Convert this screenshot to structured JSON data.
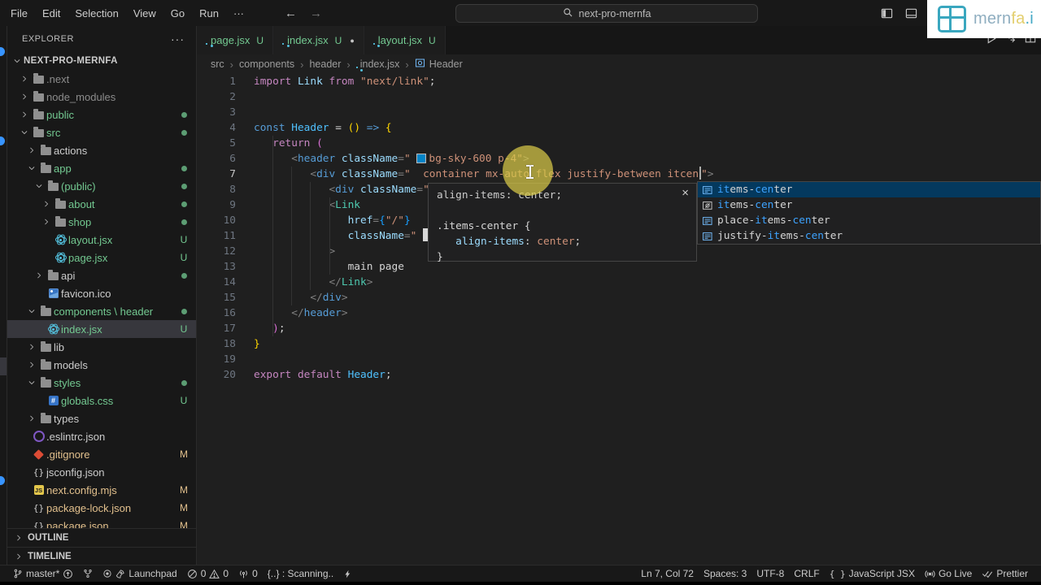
{
  "colors": {
    "untracked_green": "#73c991",
    "modified_orange": "#e2c08d",
    "suggest_selected_bg": "#04395e",
    "tailwind_chip": "#0284c7",
    "click_highlight": "#d8c948",
    "logo_teal": "#3aa7bf"
  },
  "title_bar": {
    "menus": [
      "File",
      "Edit",
      "Selection",
      "View",
      "Go",
      "Run",
      "···"
    ],
    "back_arrow": "←",
    "forward_arrow": "→",
    "search_value": "next-pro-mernfa"
  },
  "logo": {
    "parts": [
      {
        "text": "mern",
        "color": "#8fAEC0"
      },
      {
        "text": "fa",
        "color": "#e3cf6e"
      },
      {
        "text": ".i",
        "color": "#45a9c6"
      }
    ]
  },
  "explorer": {
    "header": "EXPLORER",
    "header_menu": "···",
    "sections": [
      {
        "label": "OUTLINE"
      },
      {
        "label": "TIMELINE"
      }
    ],
    "tree": [
      {
        "label": "NEXT-PRO-MERNFA",
        "depth": 0,
        "kind": "root",
        "state": "open",
        "color": "white"
      },
      {
        "label": ".next",
        "depth": 1,
        "kind": "folder",
        "state": "closed",
        "color": "gray"
      },
      {
        "label": "node_modules",
        "depth": 1,
        "kind": "folder",
        "state": "closed",
        "color": "gray"
      },
      {
        "label": "public",
        "depth": 1,
        "kind": "folder",
        "state": "closed",
        "color": "green",
        "badge": "dot"
      },
      {
        "label": "src",
        "depth": 1,
        "kind": "folder",
        "state": "open",
        "color": "green",
        "badge": "dot"
      },
      {
        "label": "actions",
        "depth": 2,
        "kind": "folder",
        "state": "closed",
        "color": "white"
      },
      {
        "label": "app",
        "depth": 2,
        "kind": "folder",
        "state": "open",
        "color": "green",
        "badge": "dot"
      },
      {
        "label": "(public)",
        "depth": 3,
        "kind": "folder",
        "state": "open",
        "color": "green",
        "badge": "dot"
      },
      {
        "label": "about",
        "depth": 4,
        "kind": "folder",
        "state": "closed",
        "color": "green",
        "badge": "dot"
      },
      {
        "label": "shop",
        "depth": 4,
        "kind": "folder",
        "state": "closed",
        "color": "green",
        "badge": "dot"
      },
      {
        "label": "layout.jsx",
        "depth": 4,
        "kind": "file",
        "icon": "react",
        "color": "green",
        "badge": "U"
      },
      {
        "label": "page.jsx",
        "depth": 4,
        "kind": "file",
        "icon": "react",
        "color": "green",
        "badge": "U"
      },
      {
        "label": "api",
        "depth": 3,
        "kind": "folder",
        "state": "closed",
        "color": "white",
        "badge": "dot"
      },
      {
        "label": "favicon.ico",
        "depth": 3,
        "kind": "file",
        "icon": "img",
        "color": "white"
      },
      {
        "label": "components \\ header",
        "depth": 2,
        "kind": "folder",
        "state": "open",
        "color": "green",
        "badge": "dot"
      },
      {
        "label": "index.jsx",
        "depth": 3,
        "kind": "file",
        "icon": "react",
        "color": "green",
        "badge": "U",
        "selected": true
      },
      {
        "label": "lib",
        "depth": 2,
        "kind": "folder",
        "state": "closed",
        "color": "white"
      },
      {
        "label": "models",
        "depth": 2,
        "kind": "folder",
        "state": "closed",
        "color": "white"
      },
      {
        "label": "styles",
        "depth": 2,
        "kind": "folder",
        "state": "open",
        "color": "green",
        "badge": "dot"
      },
      {
        "label": "globals.css",
        "depth": 3,
        "kind": "file",
        "icon": "css",
        "color": "green",
        "badge": "U"
      },
      {
        "label": "types",
        "depth": 2,
        "kind": "folder",
        "state": "closed",
        "color": "white"
      },
      {
        "label": ".eslintrc.json",
        "depth": 1,
        "kind": "file",
        "icon": "eslint",
        "color": "white"
      },
      {
        "label": ".gitignore",
        "depth": 1,
        "kind": "file",
        "icon": "git",
        "color": "orange",
        "badge": "M"
      },
      {
        "label": "jsconfig.json",
        "depth": 1,
        "kind": "file",
        "icon": "json",
        "color": "white"
      },
      {
        "label": "next.config.mjs",
        "depth": 1,
        "kind": "file",
        "icon": "js",
        "color": "orange",
        "badge": "M"
      },
      {
        "label": "package-lock.json",
        "depth": 1,
        "kind": "file",
        "icon": "json",
        "color": "orange",
        "badge": "M"
      },
      {
        "label": "package.json",
        "depth": 1,
        "kind": "file",
        "icon": "json",
        "color": "orange",
        "badge": "M"
      }
    ]
  },
  "tabs": [
    {
      "label": "page.jsx",
      "badge": "U",
      "active": false,
      "dirty": false
    },
    {
      "label": "index.jsx",
      "badge": "U",
      "active": true,
      "dirty": true
    },
    {
      "label": "layout.jsx",
      "badge": "U",
      "active": false,
      "dirty": false
    }
  ],
  "editor_actions": [
    {
      "icon": "run-icon"
    },
    {
      "icon": "open-changes-icon"
    },
    {
      "icon": "split-editor-icon"
    }
  ],
  "breadcrumb": [
    {
      "label": "src"
    },
    {
      "label": "components"
    },
    {
      "label": "header"
    },
    {
      "label": "index.jsx",
      "icon": "react"
    },
    {
      "label": "Header",
      "icon": "symbol"
    }
  ],
  "editor": {
    "current_line": 7,
    "lines": [
      {
        "num": 1,
        "segs": [
          [
            "kw",
            "import"
          ],
          [
            "txt",
            " "
          ],
          [
            "var",
            "Link"
          ],
          [
            "txt",
            " "
          ],
          [
            "kw",
            "from"
          ],
          [
            "txt",
            " "
          ],
          [
            "str",
            "\"next/link\""
          ],
          [
            "txt",
            ";"
          ]
        ]
      },
      {
        "num": 2,
        "segs": []
      },
      {
        "num": 3,
        "segs": []
      },
      {
        "num": 4,
        "segs": [
          [
            "kw2",
            "const"
          ],
          [
            "txt",
            " "
          ],
          [
            "var2",
            "Header"
          ],
          [
            "txt",
            " = "
          ],
          [
            "br1",
            "()"
          ],
          [
            "txt",
            " "
          ],
          [
            "kw2",
            "=>"
          ],
          [
            "txt",
            " "
          ],
          [
            "br1",
            "{"
          ]
        ]
      },
      {
        "num": 5,
        "segs": [
          [
            "txt",
            "   "
          ],
          [
            "kw",
            "return"
          ],
          [
            "txt",
            " "
          ],
          [
            "br2",
            "("
          ]
        ]
      },
      {
        "num": 6,
        "segs": [
          [
            "txt",
            "      "
          ],
          [
            "pun",
            "<"
          ],
          [
            "tagb",
            "header"
          ],
          [
            "txt",
            " "
          ],
          [
            "var",
            "className"
          ],
          [
            "pun",
            "="
          ],
          [
            "str",
            "\" "
          ],
          [
            "chip",
            ""
          ],
          [
            "str",
            "bg-sky-600 p-4\""
          ],
          [
            "pun",
            ">"
          ]
        ]
      },
      {
        "num": 7,
        "segs": [
          [
            "txt",
            "         "
          ],
          [
            "pun",
            "<"
          ],
          [
            "tagb",
            "div"
          ],
          [
            "txt",
            " "
          ],
          [
            "var",
            "className"
          ],
          [
            "pun",
            "="
          ],
          [
            "str",
            "\"  container mx-auto flex justify-between itcen"
          ],
          [
            "cursor",
            ""
          ],
          [
            "str",
            "\""
          ],
          [
            "pun",
            ">"
          ]
        ]
      },
      {
        "num": 8,
        "segs": [
          [
            "txt",
            "            "
          ],
          [
            "pun",
            "<"
          ],
          [
            "tagb",
            "div"
          ],
          [
            "txt",
            " "
          ],
          [
            "var",
            "className"
          ],
          [
            "pun",
            "="
          ],
          [
            "str",
            "\""
          ]
        ]
      },
      {
        "num": 9,
        "segs": [
          [
            "txt",
            "            "
          ],
          [
            "pun",
            "<"
          ],
          [
            "tagg",
            "Link"
          ]
        ]
      },
      {
        "num": 10,
        "segs": [
          [
            "txt",
            "               "
          ],
          [
            "var",
            "href"
          ],
          [
            "pun",
            "="
          ],
          [
            "br3",
            "{"
          ],
          [
            "str",
            "\"/\""
          ],
          [
            "br3",
            "}"
          ]
        ]
      },
      {
        "num": 11,
        "segs": [
          [
            "txt",
            "               "
          ],
          [
            "var",
            "className"
          ],
          [
            "pun",
            "="
          ],
          [
            "str",
            "\" "
          ],
          [
            "block",
            ""
          ]
        ]
      },
      {
        "num": 12,
        "segs": [
          [
            "txt",
            "            "
          ],
          [
            "pun",
            ">"
          ]
        ]
      },
      {
        "num": 13,
        "segs": [
          [
            "txt",
            "               "
          ],
          [
            "txt",
            "main page"
          ]
        ]
      },
      {
        "num": 14,
        "segs": [
          [
            "txt",
            "            "
          ],
          [
            "pun",
            "</"
          ],
          [
            "tagg",
            "Link"
          ],
          [
            "pun",
            ">"
          ]
        ]
      },
      {
        "num": 15,
        "segs": [
          [
            "txt",
            "         "
          ],
          [
            "pun",
            "</"
          ],
          [
            "tagb",
            "div"
          ],
          [
            "pun",
            ">"
          ]
        ]
      },
      {
        "num": 16,
        "segs": [
          [
            "txt",
            "      "
          ],
          [
            "pun",
            "</"
          ],
          [
            "tagb",
            "header"
          ],
          [
            "pun",
            ">"
          ]
        ]
      },
      {
        "num": 17,
        "segs": [
          [
            "txt",
            "   "
          ],
          [
            "br2",
            ")"
          ],
          [
            "txt",
            ";"
          ]
        ]
      },
      {
        "num": 18,
        "segs": [
          [
            "br1",
            "}"
          ]
        ]
      },
      {
        "num": 19,
        "segs": []
      },
      {
        "num": 20,
        "segs": [
          [
            "kw",
            "export"
          ],
          [
            "txt",
            " "
          ],
          [
            "kw",
            "default"
          ],
          [
            "txt",
            " "
          ],
          [
            "var2",
            "Header"
          ],
          [
            "txt",
            ";"
          ]
        ]
      }
    ]
  },
  "doc_popup": {
    "summary": "align-items: center;",
    "close_label": "×",
    "css_lines": [
      [
        [
          "plain",
          ".items-center {"
        ]
      ],
      [
        [
          "plain",
          "   "
        ],
        [
          "prop",
          "align-items"
        ],
        [
          "plain",
          ": "
        ],
        [
          "val",
          "center"
        ],
        [
          "plain",
          ";"
        ]
      ],
      [
        [
          "plain",
          "}"
        ]
      ]
    ]
  },
  "suggest": {
    "items": [
      {
        "icon": "class",
        "selected": true,
        "parts": [
          [
            "m",
            "it"
          ],
          [
            "p",
            "ems-"
          ],
          [
            "m",
            "cen"
          ],
          [
            "p",
            "ter"
          ]
        ]
      },
      {
        "icon": "field",
        "selected": false,
        "parts": [
          [
            "m",
            "it"
          ],
          [
            "p",
            "ems-"
          ],
          [
            "m",
            "cen"
          ],
          [
            "p",
            "ter"
          ]
        ]
      },
      {
        "icon": "class",
        "selected": false,
        "parts": [
          [
            "p",
            "place-"
          ],
          [
            "m",
            "it"
          ],
          [
            "p",
            "ems-"
          ],
          [
            "m",
            "cen"
          ],
          [
            "p",
            "ter"
          ]
        ]
      },
      {
        "icon": "class",
        "selected": false,
        "parts": [
          [
            "p",
            "justify-"
          ],
          [
            "m",
            "it"
          ],
          [
            "p",
            "ems-"
          ],
          [
            "m",
            "cen"
          ],
          [
            "p",
            "ter"
          ]
        ]
      }
    ]
  },
  "status_bar": {
    "left": [
      {
        "name": "git-branch",
        "parts": [
          {
            "icon": "branch-icon"
          },
          {
            "text": "master*"
          },
          {
            "icon": "publish-icon"
          }
        ]
      },
      {
        "name": "git-graph",
        "parts": [
          {
            "icon": "graph-icon"
          }
        ]
      },
      {
        "name": "launchpad",
        "parts": [
          {
            "icon": "target-icon"
          },
          {
            "icon": "rocket-icon"
          },
          {
            "text": "Launchpad"
          }
        ]
      },
      {
        "name": "problems",
        "parts": [
          {
            "icon": "error-icon"
          },
          {
            "text": "0"
          },
          {
            "icon": "warning-icon"
          },
          {
            "text": "0"
          }
        ]
      },
      {
        "name": "ports",
        "parts": [
          {
            "icon": "antenna-icon"
          },
          {
            "text": "0"
          }
        ]
      },
      {
        "name": "scanning",
        "parts": [
          {
            "text": "{..} : Scanning.."
          }
        ]
      },
      {
        "name": "zap",
        "parts": [
          {
            "icon": "zap-icon"
          }
        ]
      }
    ],
    "right": [
      {
        "name": "cursor-position",
        "parts": [
          {
            "text": "Ln 7, Col 72"
          }
        ]
      },
      {
        "name": "indentation",
        "parts": [
          {
            "text": "Spaces: 3"
          }
        ]
      },
      {
        "name": "encoding",
        "parts": [
          {
            "text": "UTF-8"
          }
        ]
      },
      {
        "name": "eol",
        "parts": [
          {
            "text": "CRLF"
          }
        ]
      },
      {
        "name": "language-mode",
        "parts": [
          {
            "icon": "braces-icon"
          },
          {
            "text": "JavaScript JSX"
          }
        ]
      },
      {
        "name": "go-live",
        "parts": [
          {
            "icon": "broadcast-icon"
          },
          {
            "text": "Go Live"
          }
        ]
      },
      {
        "name": "prettier",
        "parts": [
          {
            "icon": "double-check-icon"
          },
          {
            "text": "Prettier"
          }
        ]
      }
    ]
  }
}
